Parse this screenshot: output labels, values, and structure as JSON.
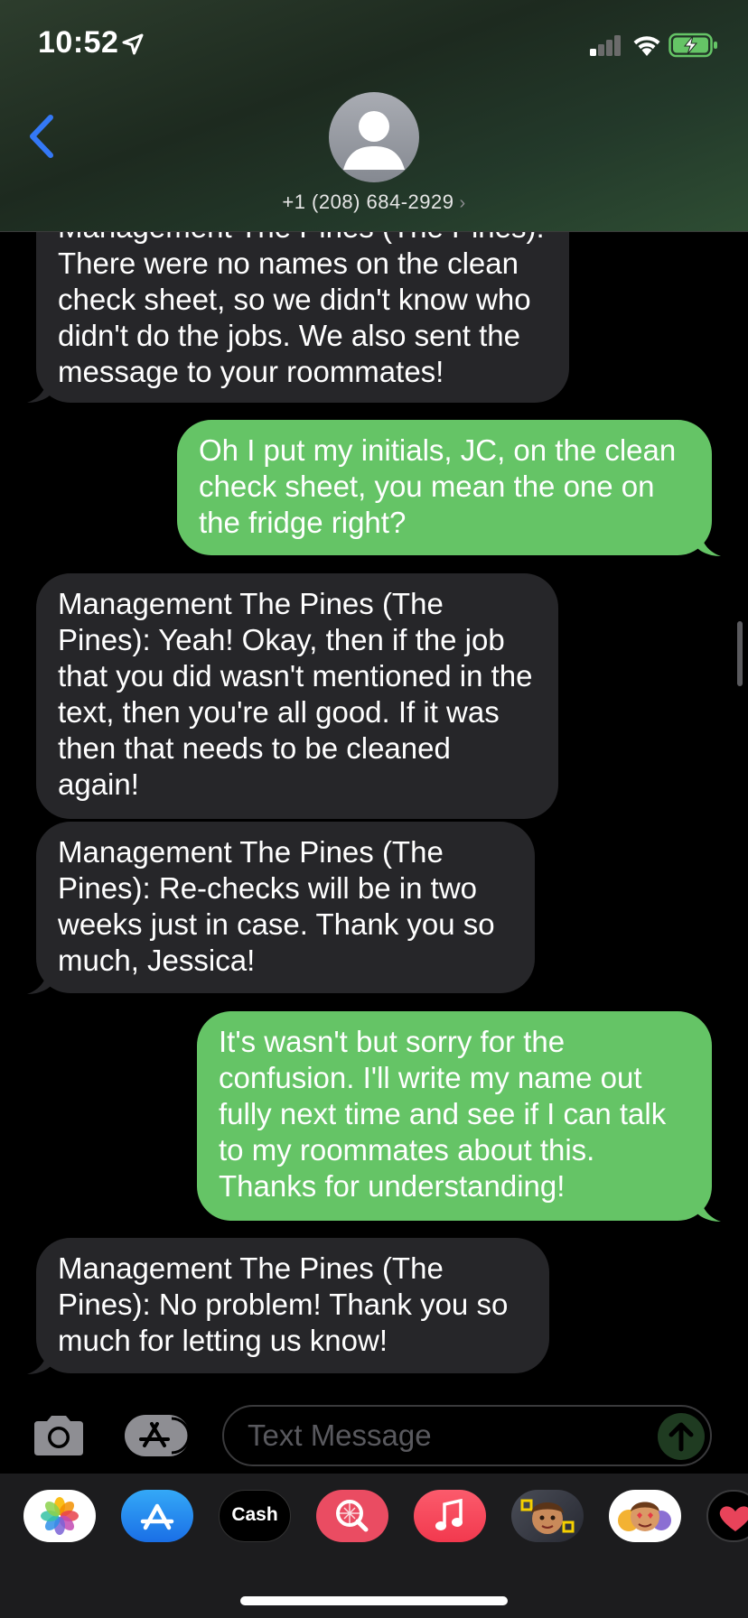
{
  "status_bar": {
    "time": "10:52"
  },
  "header": {
    "contact": "+1 (208) 684-2929"
  },
  "messages": [
    {
      "dir": "in",
      "text": "Management The Pines (The Pines): There were no names on the clean check sheet, so we didn't know who didn't do the jobs. We also sent the message to your roommates!"
    },
    {
      "dir": "out",
      "text": "Oh I put my initials, JC, on the clean check sheet, you mean the one on the fridge right?"
    },
    {
      "dir": "in",
      "text": "Management The Pines (The Pines): Yeah! Okay, then if the job that you did wasn't mentioned in the text, then you're all good. If it was then that needs to be cleaned again!"
    },
    {
      "dir": "in",
      "text": "Management The Pines (The Pines): Re-checks will be in two weeks just in case. Thank you so much, Jessica!"
    },
    {
      "dir": "out",
      "text": "It's wasn't but sorry for the confusion. I'll write my name out fully next time and see if I can talk to my roommates about this. Thanks for understanding!"
    },
    {
      "dir": "in",
      "text": "Management The Pines (The Pines): No problem! Thank you so much for letting us know!"
    }
  ],
  "composer": {
    "placeholder": "Text Message"
  },
  "dock": {
    "apps": [
      "photos-icon",
      "app-store-icon",
      "apple-cash-icon",
      "web-images-icon",
      "music-icon",
      "memoji-icon",
      "animoji-icon",
      "digital-touch-icon"
    ],
    "cash_label": "Cash"
  },
  "colors": {
    "incoming": "#262629",
    "outgoing": "#65c466",
    "accent": "#3478f6"
  }
}
